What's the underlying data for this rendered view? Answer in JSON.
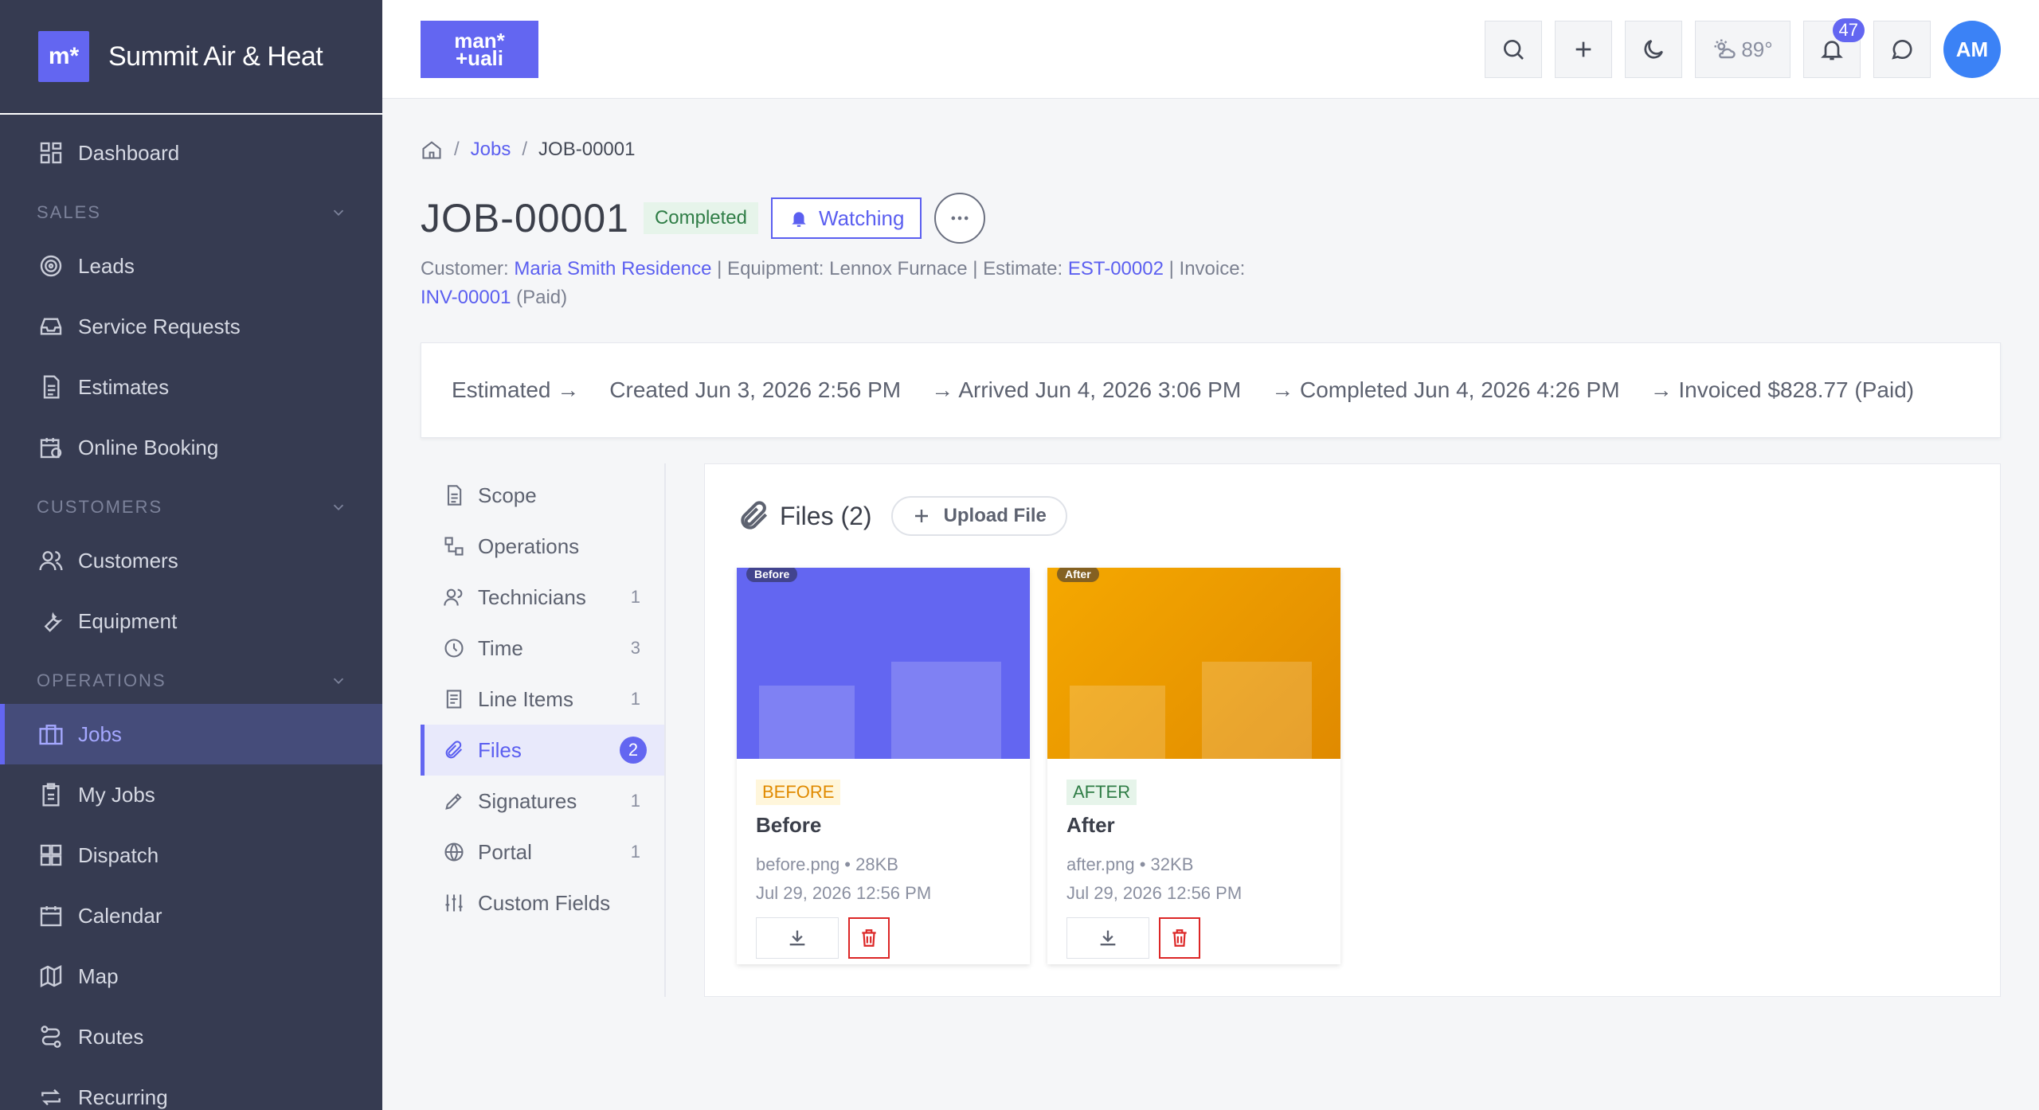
{
  "brand": {
    "logo_text": "m*",
    "name": "Summit Air & Heat"
  },
  "sidebar": {
    "items": [
      {
        "label": "Dashboard"
      },
      {
        "section": "SALES"
      },
      {
        "label": "Leads"
      },
      {
        "label": "Service Requests"
      },
      {
        "label": "Estimates"
      },
      {
        "label": "Online Booking"
      },
      {
        "section": "CUSTOMERS"
      },
      {
        "label": "Customers"
      },
      {
        "label": "Equipment"
      },
      {
        "section": "OPERATIONS"
      },
      {
        "label": "Jobs",
        "active": true
      },
      {
        "label": "My Jobs"
      },
      {
        "label": "Dispatch"
      },
      {
        "label": "Calendar"
      },
      {
        "label": "Map"
      },
      {
        "label": "Routes"
      },
      {
        "label": "Recurring"
      }
    ]
  },
  "topbar": {
    "logo_line1": "man*",
    "logo_line2": "+uali",
    "weather": "89°",
    "notification_count": "47",
    "avatar_initials": "AM"
  },
  "breadcrumb": {
    "jobs": "Jobs",
    "current": "JOB-00001"
  },
  "job": {
    "id": "JOB-00001",
    "status": "Completed",
    "watch_label": "Watching",
    "meta": {
      "customer_label": "Customer:",
      "customer": "Maria Smith Residence",
      "equipment": "| Equipment: Lennox Furnace | Estimate:",
      "estimate": "EST-00002",
      "invoice_label": "| Invoice:",
      "invoice": "INV-00001",
      "invoice_status": "(Paid)"
    }
  },
  "timeline": {
    "steps": [
      "Estimated →",
      "Created Jun 3, 2026 2:56 PM",
      "→ Arrived Jun 4, 2026 3:06 PM",
      "→ Completed Jun 4, 2026 4:26 PM",
      "→ Invoiced $828.77 (Paid)"
    ]
  },
  "tabs": [
    {
      "label": "Scope",
      "count": ""
    },
    {
      "label": "Operations",
      "count": ""
    },
    {
      "label": "Technicians",
      "count": "1"
    },
    {
      "label": "Time",
      "count": "3"
    },
    {
      "label": "Line Items",
      "count": "1"
    },
    {
      "label": "Files",
      "count": "2",
      "active": true
    },
    {
      "label": "Signatures",
      "count": "1"
    },
    {
      "label": "Portal",
      "count": "1"
    },
    {
      "label": "Custom Fields",
      "count": ""
    }
  ],
  "files": {
    "title": "Files (2)",
    "upload_label": "Upload File",
    "items": [
      {
        "thumb_tag": "Before",
        "pill": "BEFORE",
        "name": "Before",
        "file": "before.png • 28KB",
        "date": "Jul 29, 2026 12:56 PM"
      },
      {
        "thumb_tag": "After",
        "pill": "AFTER",
        "name": "After",
        "file": "after.png • 32KB",
        "date": "Jul 29, 2026 12:56 PM"
      }
    ]
  },
  "colors": {
    "accent": "#6366f1",
    "sidebar": "#363b51",
    "danger": "#dc2626"
  }
}
